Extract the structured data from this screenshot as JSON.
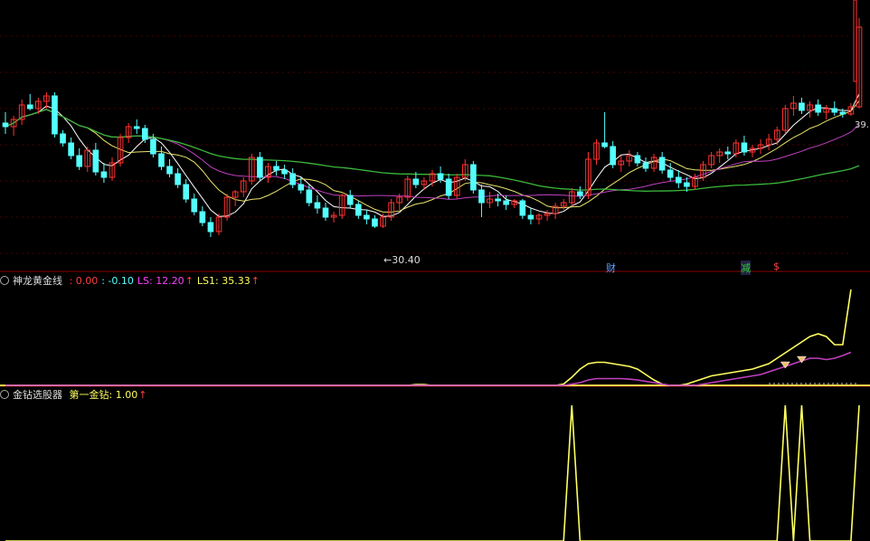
{
  "panel1": {
    "low_label": "30.40",
    "last_price": "39.",
    "event_marks": [
      "财",
      "减",
      "$"
    ],
    "colors": {
      "up": "#ff3232",
      "down": "#54ffff",
      "ma5": "#ffffff",
      "ma10": "#e8e46c",
      "ma20": "#c040c0",
      "ma60": "#3cb83c"
    }
  },
  "panel2": {
    "name": "神龙黄金线",
    "values": [
      {
        "label": ": 0.00",
        "color": "#ff4040"
      },
      {
        "label": ": -0.10",
        "color": "#54ffff"
      },
      {
        "label": "LS: 12.20",
        "color": "#ff40ff",
        "arrow": "↑"
      },
      {
        "label": "LS1: 35.33",
        "color": "#ffff60",
        "arrow": "↑"
      }
    ]
  },
  "panel3": {
    "name": "金钻选股器",
    "values": [
      {
        "label": "第一金钻: 1.00",
        "color": "#ffff60",
        "arrow": "↑"
      }
    ]
  },
  "chart_data": [
    {
      "type": "candlestick",
      "low_marker": {
        "index": 45,
        "value": 30.4
      },
      "last_value_label": "39.",
      "series": [
        {
          "name": "",
          "ohlc": [
            [
              36.2,
              36.8,
              35.6,
              36.0
            ],
            [
              36.0,
              36.6,
              35.5,
              36.4
            ],
            [
              36.4,
              37.5,
              36.1,
              37.2
            ],
            [
              37.2,
              37.8,
              36.9,
              37.0
            ],
            [
              37.0,
              37.6,
              36.7,
              37.4
            ],
            [
              37.4,
              37.9,
              37.0,
              37.7
            ],
            [
              37.7,
              37.9,
              35.4,
              35.6
            ],
            [
              35.6,
              35.8,
              34.9,
              35.1
            ],
            [
              35.1,
              35.4,
              34.2,
              34.4
            ],
            [
              34.4,
              34.8,
              33.6,
              33.8
            ],
            [
              33.8,
              34.9,
              33.5,
              34.7
            ],
            [
              34.7,
              35.1,
              33.3,
              33.5
            ],
            [
              33.5,
              34.0,
              32.9,
              33.2
            ],
            [
              33.2,
              34.3,
              33.0,
              34.0
            ],
            [
              34.0,
              35.6,
              33.8,
              35.4
            ],
            [
              35.4,
              36.2,
              35.1,
              36.0
            ],
            [
              36.0,
              36.4,
              35.6,
              35.9
            ],
            [
              35.9,
              36.1,
              35.1,
              35.3
            ],
            [
              35.3,
              35.6,
              34.3,
              34.5
            ],
            [
              34.5,
              34.9,
              33.6,
              33.8
            ],
            [
              33.8,
              34.2,
              33.2,
              33.4
            ],
            [
              33.4,
              33.7,
              32.6,
              32.8
            ],
            [
              32.8,
              33.1,
              31.8,
              32.0
            ],
            [
              32.0,
              32.3,
              31.1,
              31.3
            ],
            [
              31.3,
              31.6,
              30.5,
              30.7
            ],
            [
              30.7,
              31.0,
              29.9,
              30.2
            ],
            [
              30.2,
              31.2,
              30.0,
              31.0
            ],
            [
              31.0,
              32.3,
              30.8,
              32.1
            ],
            [
              32.1,
              32.5,
              31.6,
              32.4
            ],
            [
              32.4,
              33.2,
              32.1,
              33.0
            ],
            [
              33.0,
              34.5,
              32.8,
              34.3
            ],
            [
              34.3,
              34.6,
              33.0,
              33.2
            ],
            [
              33.2,
              34.0,
              32.9,
              33.8
            ],
            [
              33.8,
              34.1,
              33.3,
              33.6
            ],
            [
              33.6,
              33.9,
              33.1,
              33.4
            ],
            [
              33.4,
              33.7,
              32.6,
              32.8
            ],
            [
              32.8,
              33.2,
              32.3,
              32.5
            ],
            [
              32.5,
              32.8,
              31.6,
              31.8
            ],
            [
              31.8,
              32.2,
              31.2,
              31.5
            ],
            [
              31.5,
              31.8,
              30.8,
              31.0
            ],
            [
              31.0,
              31.3,
              30.7,
              31.1
            ],
            [
              31.1,
              32.3,
              30.9,
              32.2
            ],
            [
              32.2,
              32.5,
              31.5,
              31.7
            ],
            [
              31.7,
              31.9,
              30.9,
              31.1
            ],
            [
              31.1,
              31.4,
              30.6,
              30.9
            ],
            [
              30.9,
              31.1,
              30.4,
              30.5
            ],
            [
              30.5,
              31.2,
              30.4,
              31.0
            ],
            [
              31.0,
              32.0,
              30.8,
              31.8
            ],
            [
              31.8,
              32.3,
              31.4,
              32.1
            ],
            [
              32.1,
              33.3,
              31.9,
              33.1
            ],
            [
              33.1,
              33.5,
              32.6,
              32.8
            ],
            [
              32.8,
              33.2,
              32.5,
              33.0
            ],
            [
              33.0,
              33.6,
              32.7,
              33.4
            ],
            [
              33.4,
              33.8,
              32.9,
              33.1
            ],
            [
              33.1,
              33.4,
              32.0,
              32.2
            ],
            [
              32.2,
              33.4,
              32.0,
              33.2
            ],
            [
              33.2,
              34.2,
              33.0,
              33.9
            ],
            [
              33.9,
              34.1,
              32.3,
              32.5
            ],
            [
              32.5,
              32.8,
              31.0,
              31.8
            ],
            [
              31.8,
              32.4,
              31.5,
              32.0
            ],
            [
              32.0,
              32.3,
              31.6,
              31.9
            ],
            [
              31.9,
              32.2,
              31.4,
              31.7
            ],
            [
              31.7,
              32.0,
              31.5,
              31.9
            ],
            [
              31.9,
              32.0,
              30.9,
              31.1
            ],
            [
              31.1,
              31.5,
              30.6,
              30.9
            ],
            [
              30.9,
              31.2,
              30.6,
              31.1
            ],
            [
              31.1,
              31.4,
              30.8,
              31.2
            ],
            [
              31.2,
              31.8,
              30.9,
              31.6
            ],
            [
              31.6,
              32.0,
              31.4,
              31.8
            ],
            [
              31.8,
              32.6,
              31.6,
              32.4
            ],
            [
              32.4,
              32.7,
              32.0,
              32.2
            ],
            [
              32.2,
              34.6,
              32.0,
              34.2
            ],
            [
              34.2,
              35.3,
              33.9,
              35.1
            ],
            [
              35.1,
              36.8,
              34.8,
              34.9
            ],
            [
              34.9,
              35.2,
              33.7,
              33.9
            ],
            [
              33.9,
              34.4,
              33.5,
              34.1
            ],
            [
              34.1,
              34.7,
              33.8,
              34.4
            ],
            [
              34.4,
              34.6,
              33.8,
              34.0
            ],
            [
              34.0,
              34.3,
              33.5,
              33.7
            ],
            [
              33.7,
              34.5,
              33.5,
              34.3
            ],
            [
              34.3,
              34.6,
              33.4,
              33.6
            ],
            [
              33.6,
              34.0,
              33.0,
              33.2
            ],
            [
              33.2,
              33.6,
              32.6,
              32.9
            ],
            [
              32.9,
              33.2,
              32.4,
              32.7
            ],
            [
              32.7,
              33.4,
              32.5,
              33.2
            ],
            [
              33.2,
              34.1,
              33.0,
              33.9
            ],
            [
              33.9,
              34.6,
              33.7,
              34.4
            ],
            [
              34.4,
              34.8,
              34.0,
              34.6
            ],
            [
              34.6,
              34.9,
              34.2,
              34.5
            ],
            [
              34.5,
              35.3,
              34.3,
              35.1
            ],
            [
              35.1,
              35.5,
              34.4,
              34.6
            ],
            [
              34.6,
              35.0,
              34.3,
              34.8
            ],
            [
              34.8,
              35.3,
              34.5,
              35.0
            ],
            [
              35.0,
              35.6,
              34.7,
              35.3
            ],
            [
              35.3,
              36.0,
              35.0,
              35.8
            ],
            [
              35.8,
              37.2,
              35.6,
              37.0
            ],
            [
              37.0,
              37.7,
              36.6,
              37.3
            ],
            [
              37.3,
              37.6,
              36.7,
              36.9
            ],
            [
              36.9,
              37.4,
              36.5,
              37.2
            ],
            [
              37.2,
              37.5,
              36.6,
              36.8
            ],
            [
              36.8,
              37.2,
              36.4,
              37.0
            ],
            [
              37.0,
              37.4,
              36.6,
              36.8
            ],
            [
              36.8,
              37.0,
              36.5,
              36.7
            ],
            [
              36.7,
              37.3,
              36.6,
              37.1
            ],
            [
              37.1,
              42.0,
              37.0,
              41.5
            ]
          ]
        }
      ]
    },
    {
      "type": "line",
      "series": [
        {
          "name": "LS",
          "values": [
            0,
            0,
            0,
            0,
            0,
            0,
            0,
            0,
            0,
            0,
            0,
            0,
            0,
            0,
            0,
            0,
            0,
            0,
            0,
            0,
            0,
            0,
            0,
            0,
            0,
            0,
            0,
            0,
            0,
            0,
            0,
            0,
            0,
            0,
            0,
            0,
            0,
            0,
            0,
            0,
            0,
            0,
            0,
            0,
            0,
            0,
            0,
            0,
            0,
            0,
            0,
            0,
            0,
            0,
            0,
            0,
            0,
            0,
            0,
            0,
            0,
            0,
            0,
            0,
            0,
            0,
            0,
            0,
            0,
            0.5,
            1,
            2,
            2.5,
            2.5,
            2.5,
            2.5,
            2.3,
            2,
            1.5,
            1,
            0.5,
            0,
            0,
            0,
            0,
            0.5,
            1,
            1.5,
            2,
            2.5,
            3,
            3.5,
            4,
            5,
            6,
            7,
            8,
            9,
            10,
            10,
            9.5,
            10,
            11,
            12.2
          ]
        },
        {
          "name": "LS1",
          "values": [
            0,
            0,
            0,
            0,
            0,
            0,
            0,
            0,
            0,
            0,
            0,
            0,
            0,
            0,
            0,
            0,
            0,
            0,
            0,
            0,
            0,
            0,
            0,
            0,
            0,
            0,
            0,
            0,
            0,
            0,
            0,
            0,
            0,
            0,
            0,
            0,
            0,
            0,
            0,
            0,
            0,
            0,
            0,
            0,
            0,
            0,
            0,
            0,
            0,
            0,
            0.3,
            0.3,
            0,
            0,
            0,
            0,
            0,
            0,
            0,
            0,
            0,
            0,
            0,
            0,
            0,
            0,
            0,
            0,
            0.5,
            3,
            6,
            8,
            8.5,
            8.5,
            8,
            7.5,
            7,
            6,
            4,
            2,
            0.5,
            0,
            0,
            0.5,
            1.5,
            2.5,
            3.5,
            4,
            4.5,
            5,
            5.5,
            6,
            7,
            8,
            10,
            12,
            14,
            16,
            18,
            19,
            18,
            15,
            15,
            35.33
          ]
        }
      ]
    },
    {
      "type": "line",
      "series": [
        {
          "name": "第一金钻",
          "values": [
            0,
            0,
            0,
            0,
            0,
            0,
            0,
            0,
            0,
            0,
            0,
            0,
            0,
            0,
            0,
            0,
            0,
            0,
            0,
            0,
            0,
            0,
            0,
            0,
            0,
            0,
            0,
            0,
            0,
            0,
            0,
            0,
            0,
            0,
            0,
            0,
            0,
            0,
            0,
            0,
            0,
            0,
            0,
            0,
            0,
            0,
            0,
            0,
            0,
            0,
            0,
            0,
            0,
            0,
            0,
            0,
            0,
            0,
            0,
            0,
            0,
            0,
            0,
            0,
            0,
            0,
            0,
            0,
            0,
            1,
            0,
            0,
            0,
            0,
            0,
            0,
            0,
            0,
            0,
            0,
            0,
            0,
            0,
            0,
            0,
            0,
            0,
            0,
            0,
            0,
            0,
            0,
            0,
            0,
            0,
            1,
            0,
            1,
            0,
            0,
            0,
            0,
            0,
            0,
            1
          ]
        }
      ]
    }
  ]
}
